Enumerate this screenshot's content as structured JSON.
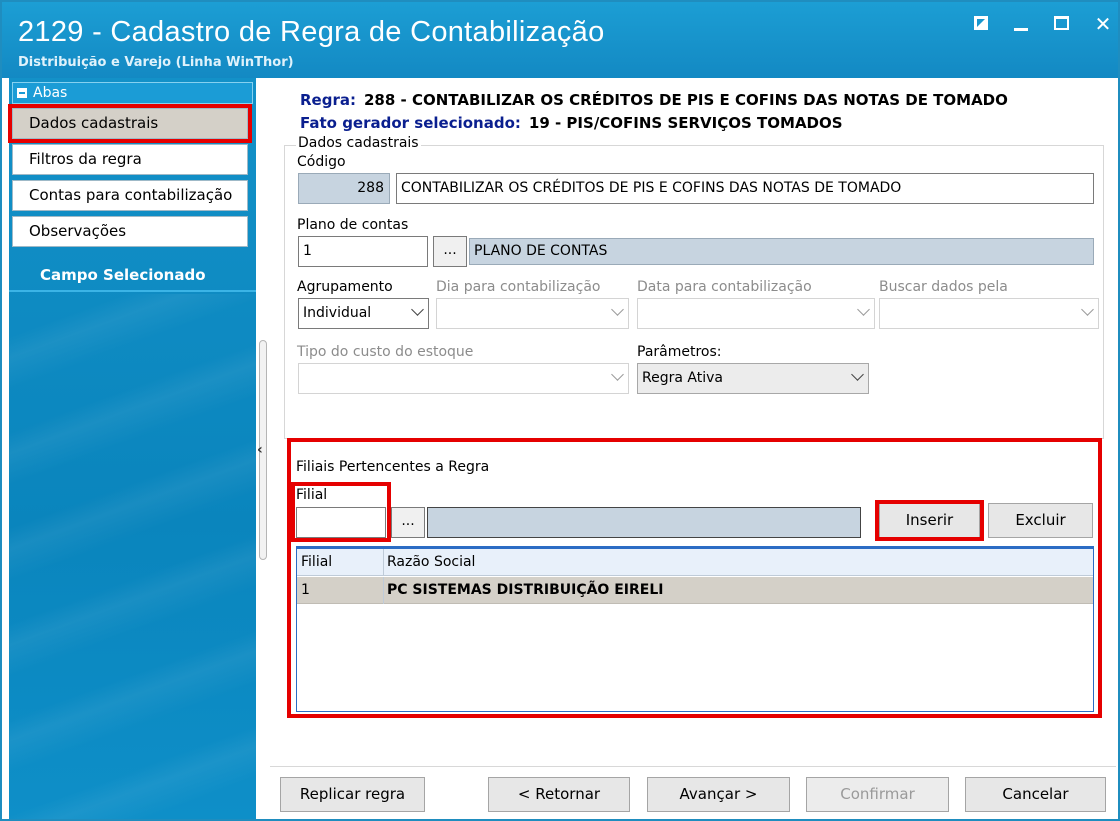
{
  "window": {
    "title": "2129 - Cadastro de Regra de Contabilização",
    "subtitle": "Distribuição e Varejo (Linha WinThor)"
  },
  "sidebar": {
    "header": "Abas",
    "items": [
      {
        "label": "Dados cadastrais"
      },
      {
        "label": "Filtros da regra"
      },
      {
        "label": "Contas para contabilização"
      },
      {
        "label": "Observações"
      }
    ],
    "campo_selecionado": "Campo Selecionado"
  },
  "rule": {
    "regra_label": "Regra:",
    "regra_value": "288 - CONTABILIZAR OS CRÉDITOS DE PIS E COFINS DAS NOTAS DE TOMADO",
    "fato_label": "Fato gerador selecionado:",
    "fato_value": "19 - PIS/COFINS SERVIÇOS TOMADOS"
  },
  "dados": {
    "group_title": "Dados cadastrais",
    "codigo_label": "Código",
    "codigo_value": "288",
    "descricao_value": "CONTABILIZAR OS CRÉDITOS DE PIS E COFINS DAS NOTAS DE TOMADO",
    "plano_label": "Plano de contas",
    "plano_value": "1",
    "plano_desc": "PLANO DE CONTAS",
    "dots": "...",
    "agrupamento_label": "Agrupamento",
    "agrupamento_value": "Individual",
    "dia_label": "Dia para contabilização",
    "data_label": "Data para contabilização",
    "buscar_label": "Buscar dados pela",
    "tipo_custo_label": "Tipo do custo do estoque",
    "parametros_label": "Parâmetros:",
    "parametros_value": "Regra Ativa"
  },
  "filiais": {
    "group_title": "Filiais Pertencentes a Regra",
    "filial_label": "Filial",
    "filial_value": "",
    "dots": "...",
    "inserir": "Inserir",
    "excluir": "Excluir",
    "columns": [
      "Filial",
      "Razão Social"
    ],
    "rows": [
      {
        "filial": "1",
        "razao": "PC SISTEMAS DISTRIBUIÇÃO  EIRELI"
      }
    ]
  },
  "footer": {
    "replicar": "Replicar regra",
    "retornar": "< Retornar",
    "avancar": "Avançar >",
    "confirmar": "Confirmar",
    "cancelar": "Cancelar"
  }
}
